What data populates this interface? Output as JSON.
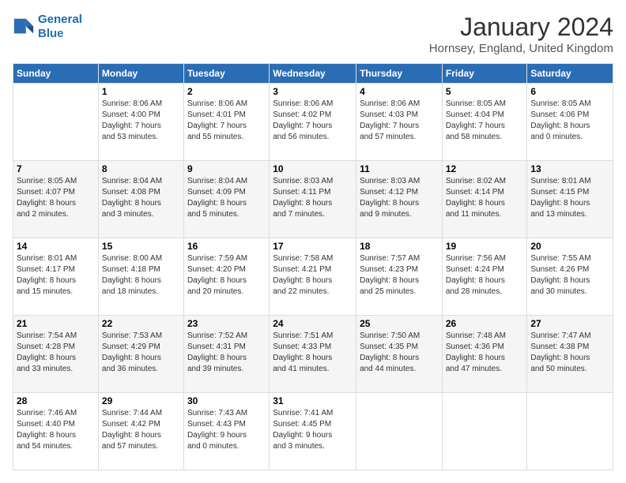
{
  "header": {
    "logo_line1": "General",
    "logo_line2": "Blue",
    "month_title": "January 2024",
    "location": "Hornsey, England, United Kingdom"
  },
  "days_of_week": [
    "Sunday",
    "Monday",
    "Tuesday",
    "Wednesday",
    "Thursday",
    "Friday",
    "Saturday"
  ],
  "weeks": [
    [
      {
        "day": "",
        "content": ""
      },
      {
        "day": "1",
        "content": "Sunrise: 8:06 AM\nSunset: 4:00 PM\nDaylight: 7 hours\nand 53 minutes."
      },
      {
        "day": "2",
        "content": "Sunrise: 8:06 AM\nSunset: 4:01 PM\nDaylight: 7 hours\nand 55 minutes."
      },
      {
        "day": "3",
        "content": "Sunrise: 8:06 AM\nSunset: 4:02 PM\nDaylight: 7 hours\nand 56 minutes."
      },
      {
        "day": "4",
        "content": "Sunrise: 8:06 AM\nSunset: 4:03 PM\nDaylight: 7 hours\nand 57 minutes."
      },
      {
        "day": "5",
        "content": "Sunrise: 8:05 AM\nSunset: 4:04 PM\nDaylight: 7 hours\nand 58 minutes."
      },
      {
        "day": "6",
        "content": "Sunrise: 8:05 AM\nSunset: 4:06 PM\nDaylight: 8 hours\nand 0 minutes."
      }
    ],
    [
      {
        "day": "7",
        "content": "Sunrise: 8:05 AM\nSunset: 4:07 PM\nDaylight: 8 hours\nand 2 minutes."
      },
      {
        "day": "8",
        "content": "Sunrise: 8:04 AM\nSunset: 4:08 PM\nDaylight: 8 hours\nand 3 minutes."
      },
      {
        "day": "9",
        "content": "Sunrise: 8:04 AM\nSunset: 4:09 PM\nDaylight: 8 hours\nand 5 minutes."
      },
      {
        "day": "10",
        "content": "Sunrise: 8:03 AM\nSunset: 4:11 PM\nDaylight: 8 hours\nand 7 minutes."
      },
      {
        "day": "11",
        "content": "Sunrise: 8:03 AM\nSunset: 4:12 PM\nDaylight: 8 hours\nand 9 minutes."
      },
      {
        "day": "12",
        "content": "Sunrise: 8:02 AM\nSunset: 4:14 PM\nDaylight: 8 hours\nand 11 minutes."
      },
      {
        "day": "13",
        "content": "Sunrise: 8:01 AM\nSunset: 4:15 PM\nDaylight: 8 hours\nand 13 minutes."
      }
    ],
    [
      {
        "day": "14",
        "content": "Sunrise: 8:01 AM\nSunset: 4:17 PM\nDaylight: 8 hours\nand 15 minutes."
      },
      {
        "day": "15",
        "content": "Sunrise: 8:00 AM\nSunset: 4:18 PM\nDaylight: 8 hours\nand 18 minutes."
      },
      {
        "day": "16",
        "content": "Sunrise: 7:59 AM\nSunset: 4:20 PM\nDaylight: 8 hours\nand 20 minutes."
      },
      {
        "day": "17",
        "content": "Sunrise: 7:58 AM\nSunset: 4:21 PM\nDaylight: 8 hours\nand 22 minutes."
      },
      {
        "day": "18",
        "content": "Sunrise: 7:57 AM\nSunset: 4:23 PM\nDaylight: 8 hours\nand 25 minutes."
      },
      {
        "day": "19",
        "content": "Sunrise: 7:56 AM\nSunset: 4:24 PM\nDaylight: 8 hours\nand 28 minutes."
      },
      {
        "day": "20",
        "content": "Sunrise: 7:55 AM\nSunset: 4:26 PM\nDaylight: 8 hours\nand 30 minutes."
      }
    ],
    [
      {
        "day": "21",
        "content": "Sunrise: 7:54 AM\nSunset: 4:28 PM\nDaylight: 8 hours\nand 33 minutes."
      },
      {
        "day": "22",
        "content": "Sunrise: 7:53 AM\nSunset: 4:29 PM\nDaylight: 8 hours\nand 36 minutes."
      },
      {
        "day": "23",
        "content": "Sunrise: 7:52 AM\nSunset: 4:31 PM\nDaylight: 8 hours\nand 39 minutes."
      },
      {
        "day": "24",
        "content": "Sunrise: 7:51 AM\nSunset: 4:33 PM\nDaylight: 8 hours\nand 41 minutes."
      },
      {
        "day": "25",
        "content": "Sunrise: 7:50 AM\nSunset: 4:35 PM\nDaylight: 8 hours\nand 44 minutes."
      },
      {
        "day": "26",
        "content": "Sunrise: 7:48 AM\nSunset: 4:36 PM\nDaylight: 8 hours\nand 47 minutes."
      },
      {
        "day": "27",
        "content": "Sunrise: 7:47 AM\nSunset: 4:38 PM\nDaylight: 8 hours\nand 50 minutes."
      }
    ],
    [
      {
        "day": "28",
        "content": "Sunrise: 7:46 AM\nSunset: 4:40 PM\nDaylight: 8 hours\nand 54 minutes."
      },
      {
        "day": "29",
        "content": "Sunrise: 7:44 AM\nSunset: 4:42 PM\nDaylight: 8 hours\nand 57 minutes."
      },
      {
        "day": "30",
        "content": "Sunrise: 7:43 AM\nSunset: 4:43 PM\nDaylight: 9 hours\nand 0 minutes."
      },
      {
        "day": "31",
        "content": "Sunrise: 7:41 AM\nSunset: 4:45 PM\nDaylight: 9 hours\nand 3 minutes."
      },
      {
        "day": "",
        "content": ""
      },
      {
        "day": "",
        "content": ""
      },
      {
        "day": "",
        "content": ""
      }
    ]
  ]
}
